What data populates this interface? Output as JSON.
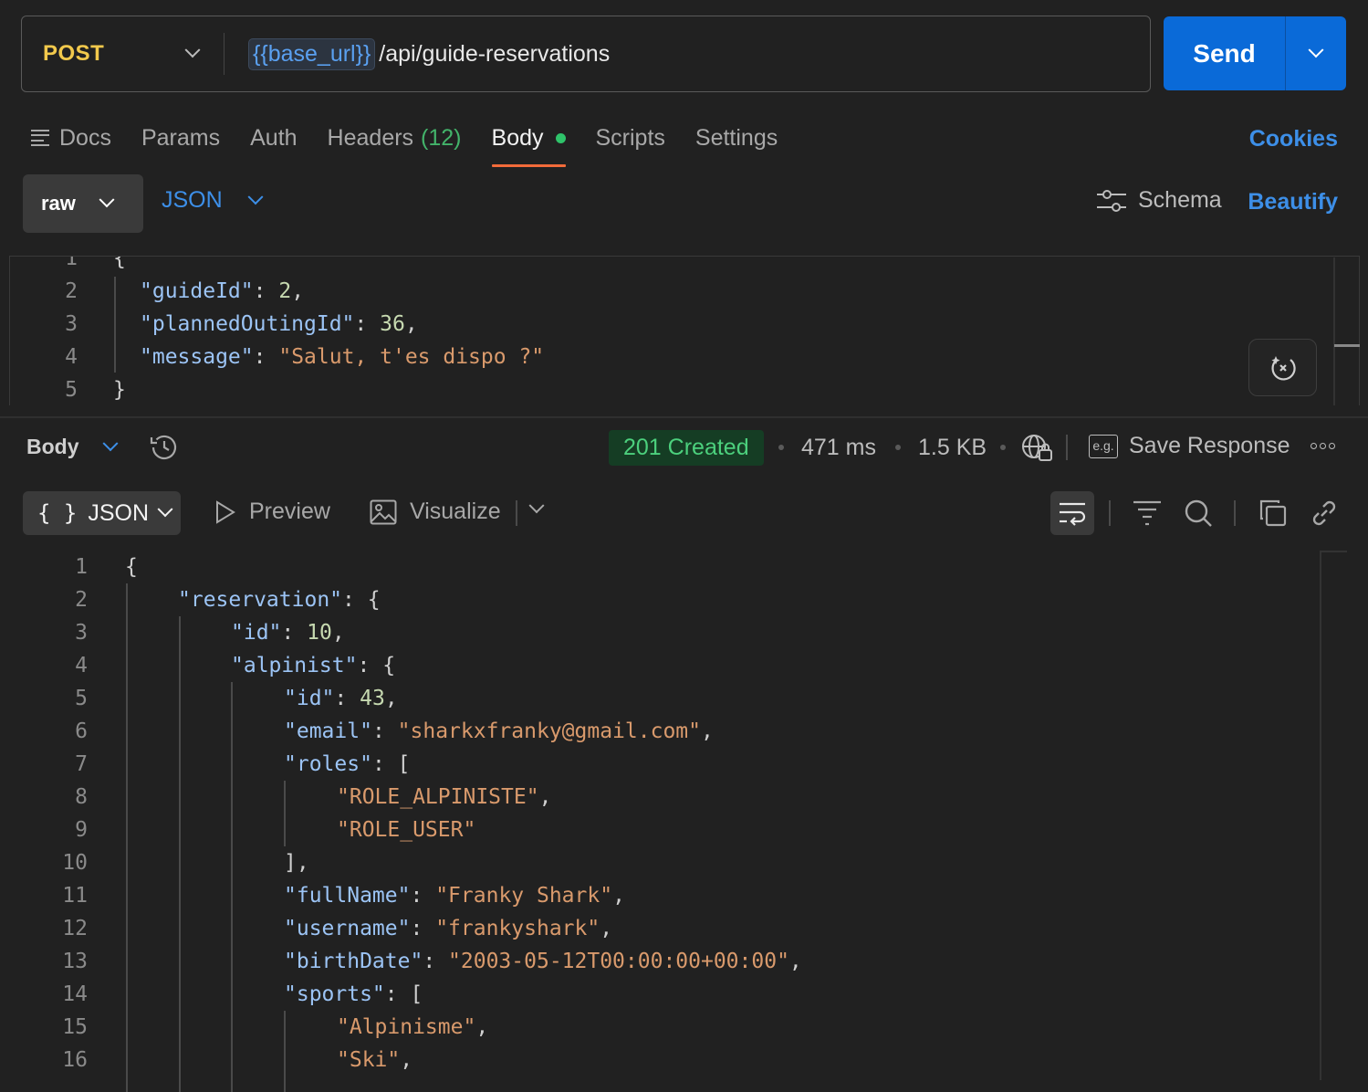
{
  "request": {
    "method": "POST",
    "url_variable": "{{base_url}}",
    "url_path": "/api/guide-reservations",
    "send_label": "Send"
  },
  "tabs": [
    {
      "label": "Docs"
    },
    {
      "label": "Params"
    },
    {
      "label": "Auth"
    },
    {
      "label": "Headers",
      "count": "(12)"
    },
    {
      "label": "Body",
      "active": true
    },
    {
      "label": "Scripts"
    },
    {
      "label": "Settings"
    }
  ],
  "cookies_label": "Cookies",
  "body_mode": "raw",
  "body_format": "JSON",
  "schema_label": "Schema",
  "beautify_label": "Beautify",
  "request_body_lines": [
    {
      "n": "1",
      "t": "{"
    },
    {
      "n": "2",
      "t": "\"guideId\": 2,"
    },
    {
      "n": "3",
      "t": "\"plannedOutingId\": 36,"
    },
    {
      "n": "4",
      "t": "\"message\": \"Salut, t'es dispo ?\""
    },
    {
      "n": "5",
      "t": "}"
    }
  ],
  "response": {
    "body_label": "Body",
    "status": "201 Created",
    "time": "471 ms",
    "size": "1.5 KB",
    "save_label": "Save Response",
    "eg_label": "e.g.",
    "view_format": "JSON",
    "preview_label": "Preview",
    "visualize_label": "Visualize",
    "lines": [
      {
        "n": "1",
        "t": "{"
      },
      {
        "n": "2",
        "t": "\"reservation\": {"
      },
      {
        "n": "3",
        "t": "\"id\": 10,"
      },
      {
        "n": "4",
        "t": "\"alpinist\": {"
      },
      {
        "n": "5",
        "t": "\"id\": 43,"
      },
      {
        "n": "6",
        "t": "\"email\": \"sharkxfranky@gmail.com\","
      },
      {
        "n": "7",
        "t": "\"roles\": ["
      },
      {
        "n": "8",
        "t": "\"ROLE_ALPINISTE\","
      },
      {
        "n": "9",
        "t": "\"ROLE_USER\""
      },
      {
        "n": "10",
        "t": "],"
      },
      {
        "n": "11",
        "t": "\"fullName\": \"Franky Shark\","
      },
      {
        "n": "12",
        "t": "\"username\": \"frankyshark\","
      },
      {
        "n": "13",
        "t": "\"birthDate\": \"2003-05-12T00:00:00+00:00\","
      },
      {
        "n": "14",
        "t": "\"sports\": ["
      },
      {
        "n": "15",
        "t": "\"Alpinisme\","
      },
      {
        "n": "16",
        "t": "\"Ski\","
      }
    ]
  },
  "colors": {
    "accent": "#0a6ad8",
    "method": "#f2c94c",
    "status_ok": "#4cd07d",
    "active_tab_underline": "#f26b3a",
    "link": "#3d8fe8"
  }
}
